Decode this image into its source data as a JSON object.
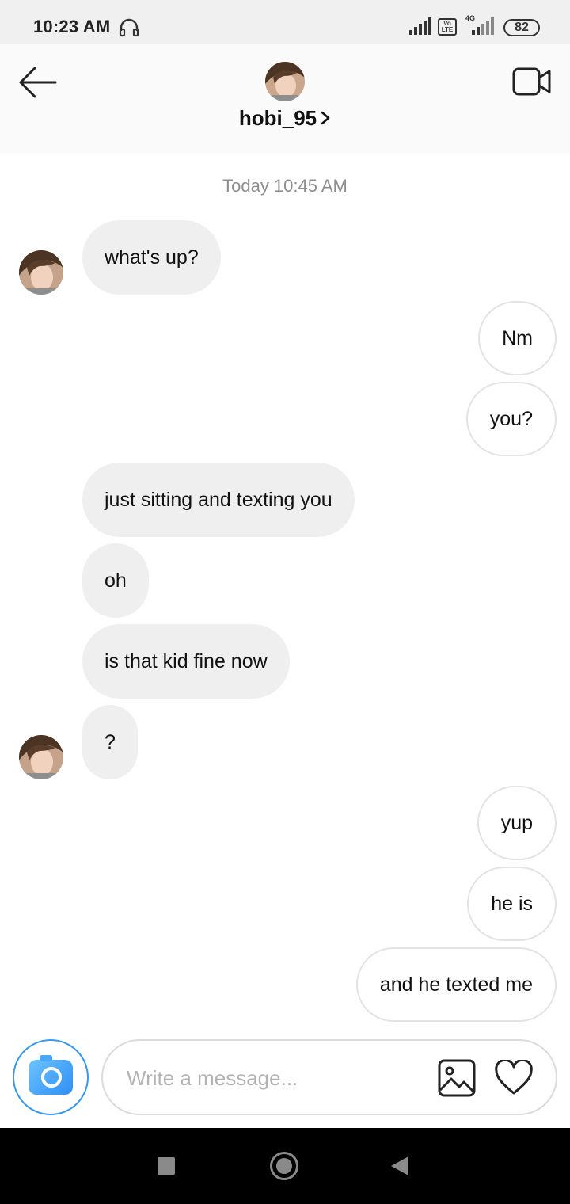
{
  "status_bar": {
    "time": "10:23 AM",
    "network_label": "4G",
    "volte_label": "Vo LTE",
    "battery": "82",
    "icons": [
      "headset-icon",
      "signal-icon",
      "volte-icon",
      "signal-icon",
      "battery-icon"
    ]
  },
  "header": {
    "username": "hobi_95",
    "icons": [
      "back-arrow-icon",
      "chevron-right-icon",
      "video-call-icon"
    ]
  },
  "conversation": {
    "timestamp": "Today 10:45 AM",
    "messages": [
      {
        "from": "them",
        "text": "what's up?"
      },
      {
        "from": "me",
        "text": "Nm"
      },
      {
        "from": "me",
        "text": "you?"
      },
      {
        "from": "them",
        "text": "just sitting and texting you"
      },
      {
        "from": "them",
        "text": "oh"
      },
      {
        "from": "them",
        "text": "is that kid fine now"
      },
      {
        "from": "them",
        "text": "?"
      },
      {
        "from": "me",
        "text": "yup"
      },
      {
        "from": "me",
        "text": "he is"
      },
      {
        "from": "me",
        "text": "and he texted me"
      }
    ]
  },
  "composer": {
    "placeholder": "Write a message...",
    "value": "",
    "icons": [
      "camera-icon",
      "gallery-icon",
      "heart-icon"
    ]
  },
  "nav_bar": {
    "icons": [
      "recents-icon",
      "home-icon",
      "back-icon"
    ]
  },
  "colors": {
    "incoming_bubble": "#efefef",
    "outgoing_bubble_border": "#e3e3e3",
    "accent": "#3897f0",
    "timestamp_text": "#8e8e8e"
  }
}
